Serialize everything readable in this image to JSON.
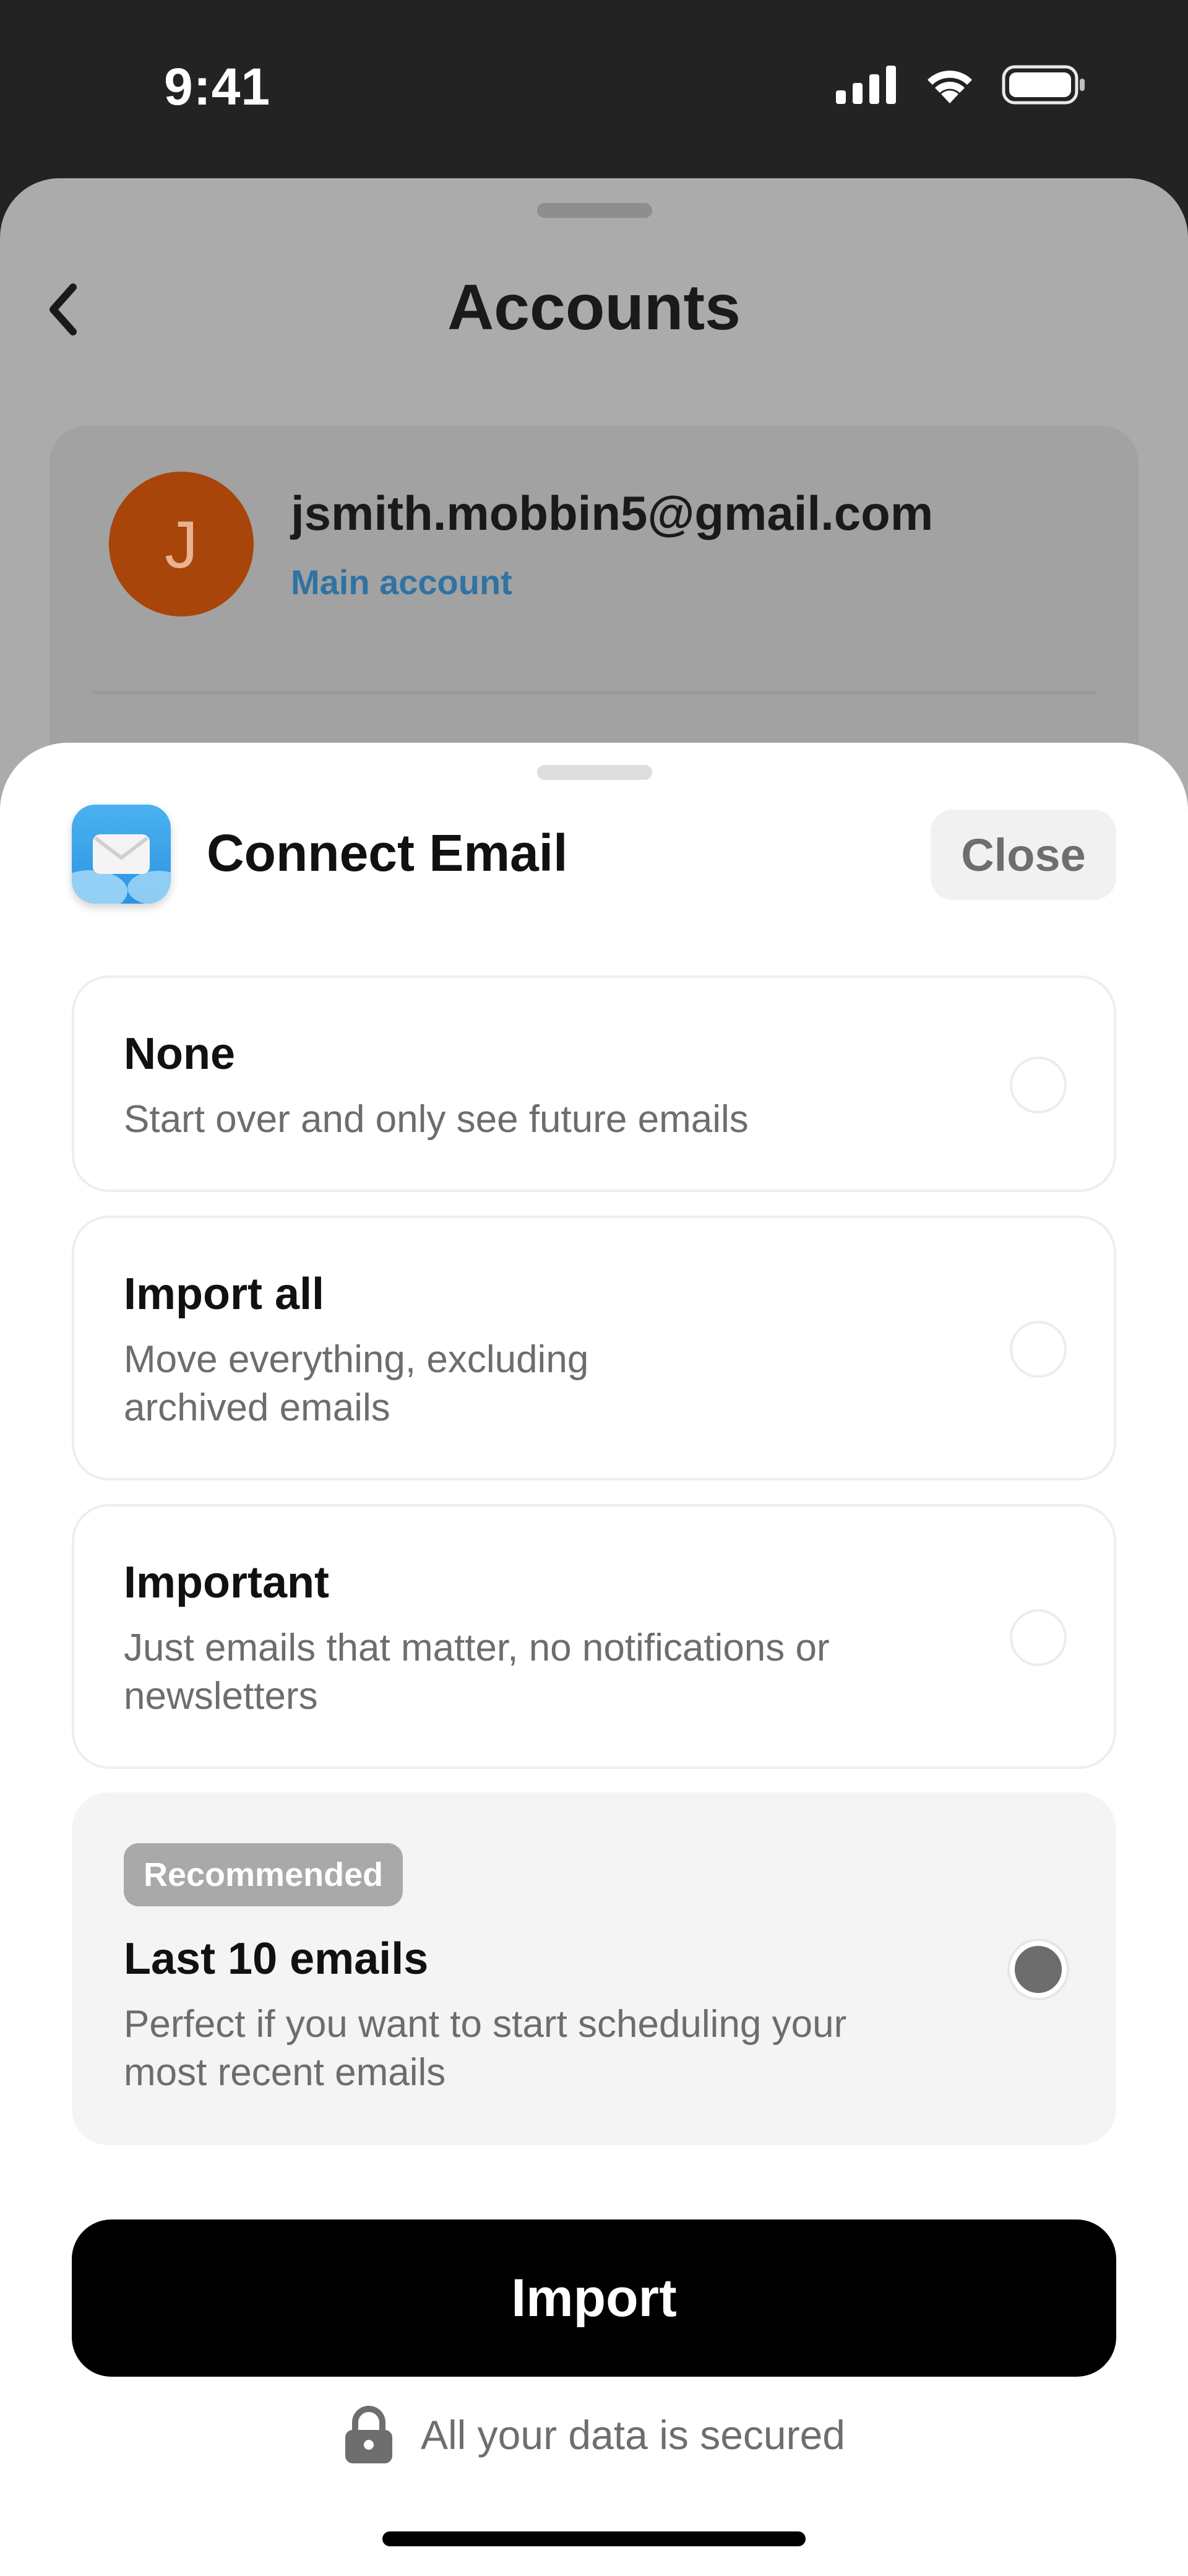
{
  "status_bar": {
    "time": "9:41"
  },
  "background_screen": {
    "title": "Accounts",
    "account": {
      "avatar_initial": "J",
      "email": "jsmith.mobbin5@gmail.com",
      "label": "Main account"
    }
  },
  "sheet": {
    "title": "Connect Email",
    "close_label": "Close",
    "options": [
      {
        "title": "None",
        "description": "Start over and only see future emails",
        "selected": false
      },
      {
        "title": "Import all",
        "description": "Move everything, excluding archived emails",
        "selected": false
      },
      {
        "title": "Important",
        "description": "Just emails that matter, no notifications or newsletters",
        "selected": false
      },
      {
        "badge": "Recommended",
        "title": "Last 10 emails",
        "description": "Perfect if you want to start scheduling your most recent emails",
        "selected": true
      }
    ],
    "import_label": "Import",
    "secure_text": "All your data is secured"
  },
  "colors": {
    "avatar": "#a8450b",
    "link": "#2f73a3",
    "primary_button": "#000000",
    "selected_option": "#f4f4f4"
  }
}
